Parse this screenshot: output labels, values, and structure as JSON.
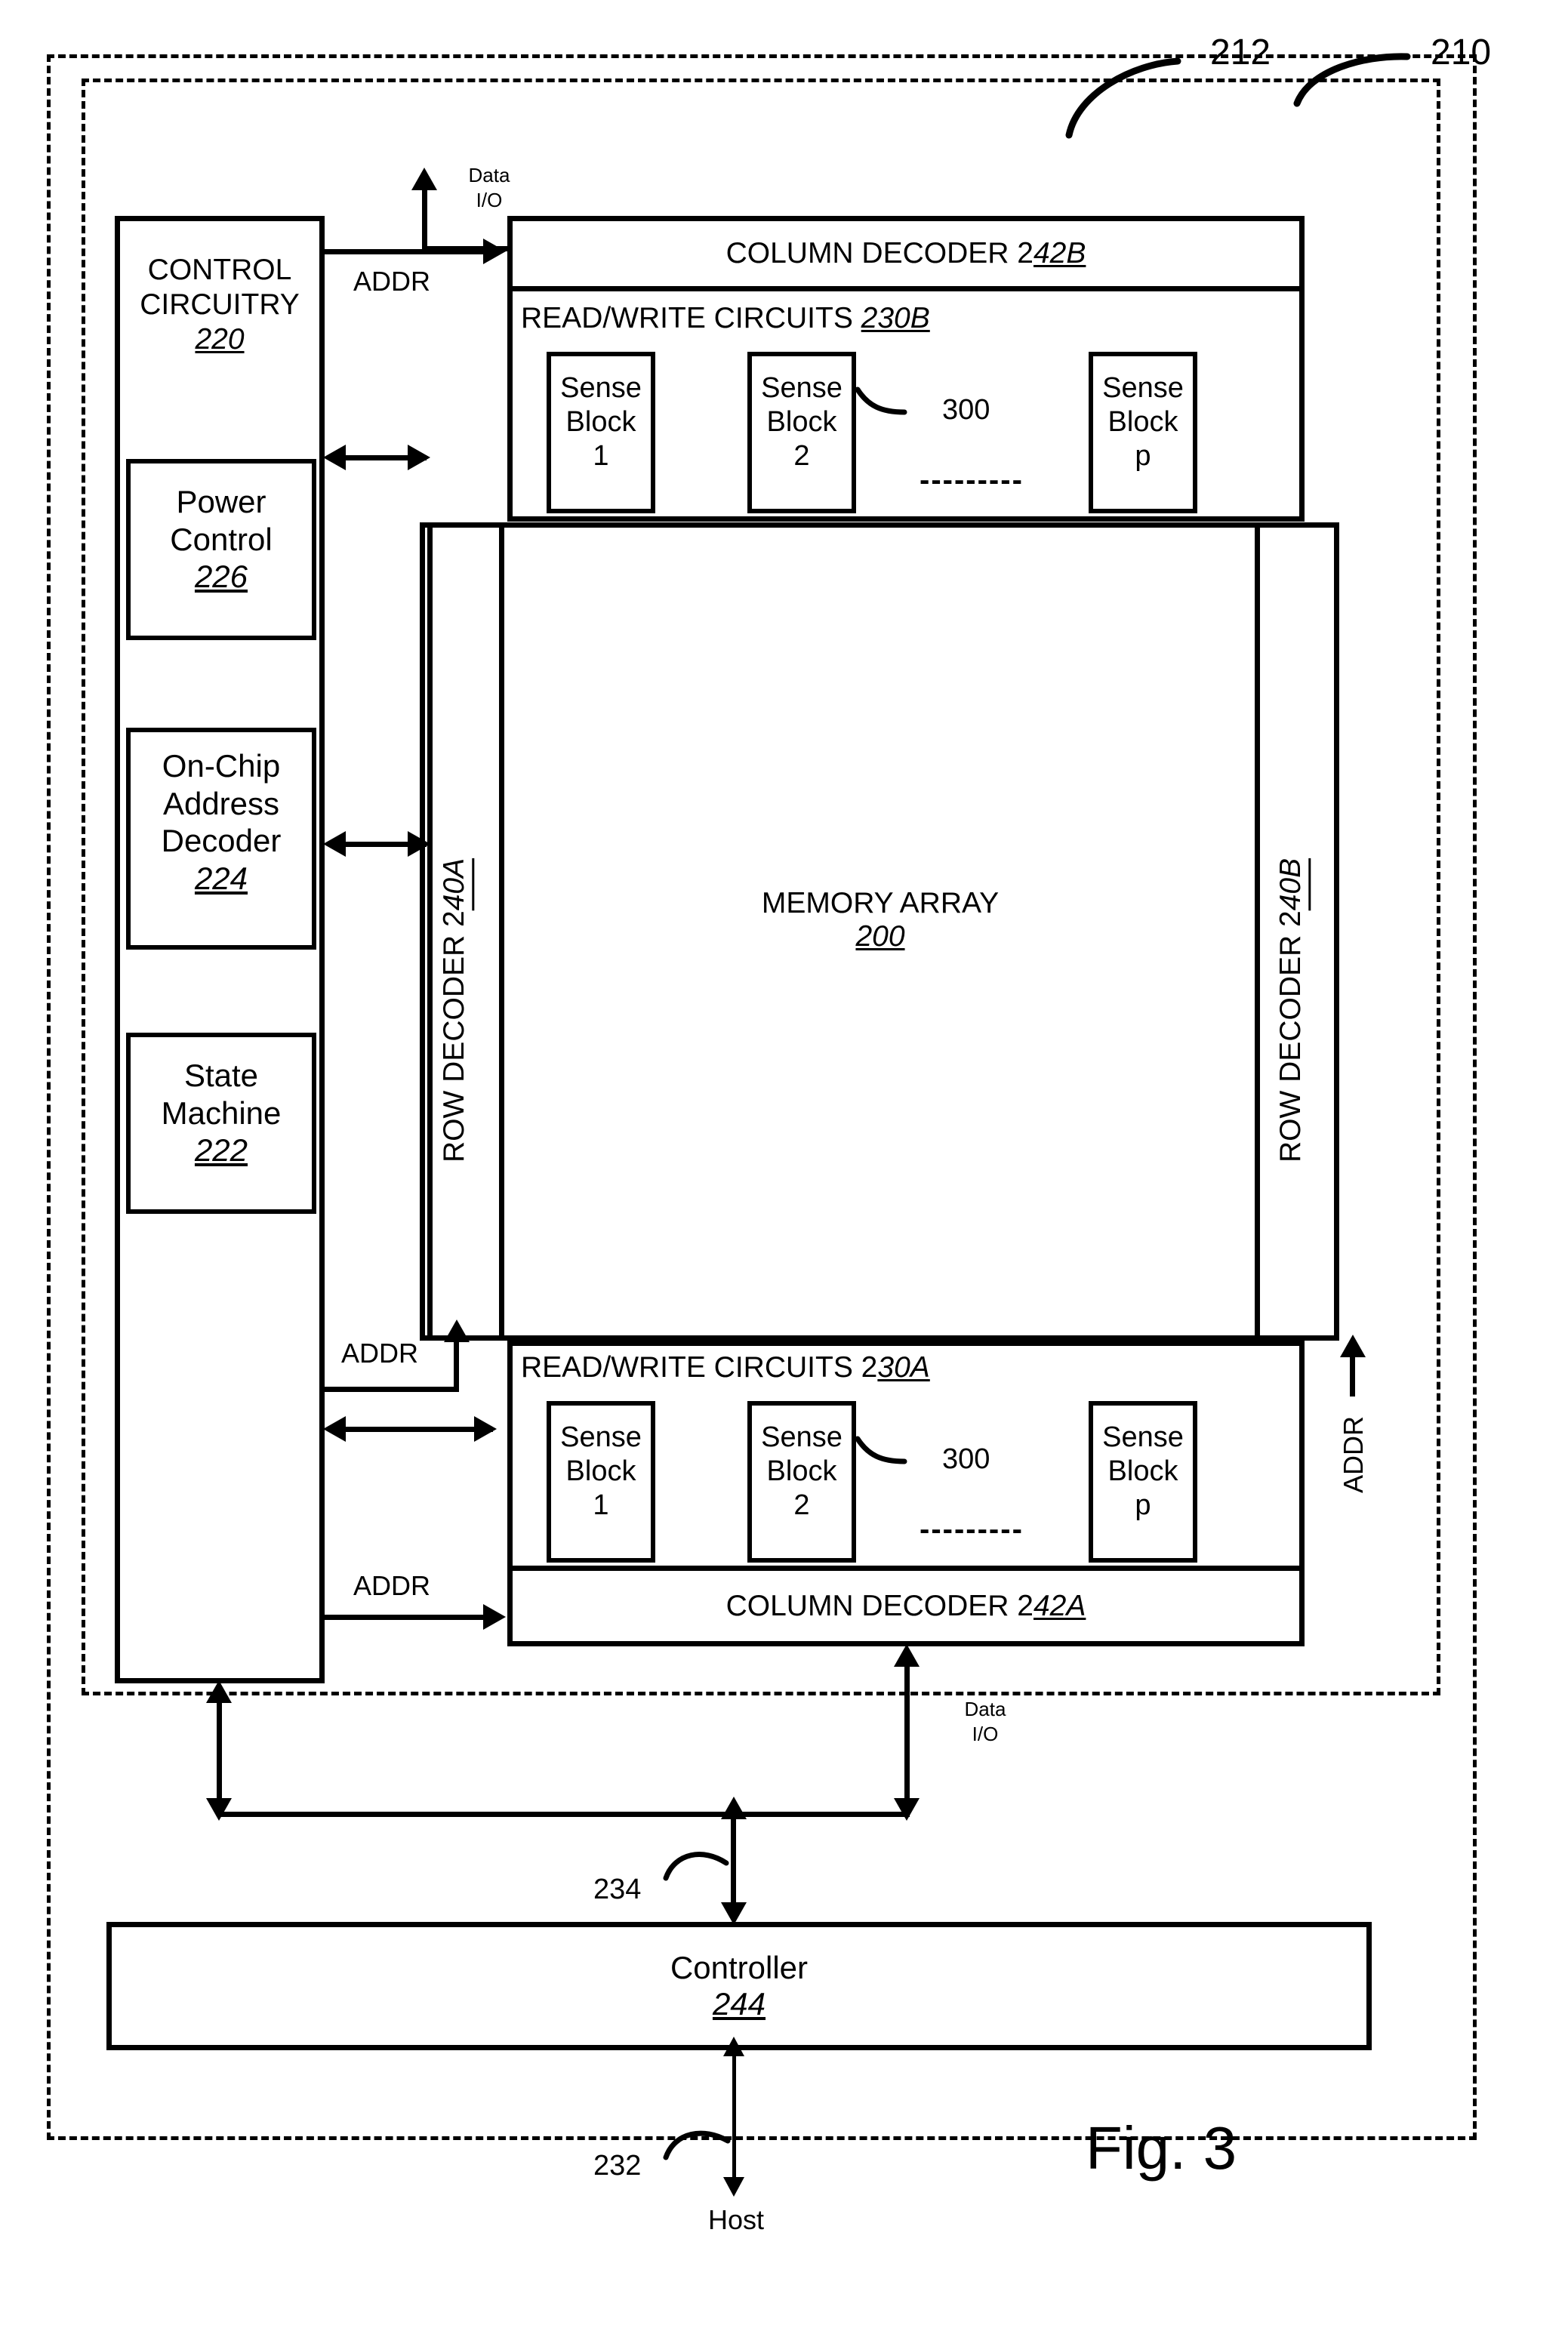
{
  "figure": {
    "caption": "Fig. 3",
    "outer_ref": "210",
    "inner_ref": "212"
  },
  "control": {
    "title_line1": "CONTROL",
    "title_line2": "CIRCUITRY",
    "ref": "220",
    "blocks": [
      {
        "name": "power-control",
        "line1": "Power",
        "line2": "Control",
        "ref": "226"
      },
      {
        "name": "on-chip-address-decoder",
        "line1": "On-Chip",
        "line2": "Address",
        "line3": "Decoder",
        "ref": "224"
      },
      {
        "name": "state-machine",
        "line1": "State",
        "line2": "Machine",
        "ref": "222"
      }
    ]
  },
  "column_decoder_top": {
    "label": "COLUMN DECODER 2",
    "ref": "42B"
  },
  "column_decoder_bottom": {
    "label": "COLUMN DECODER 2",
    "ref": "42A"
  },
  "read_write_top": {
    "label": "READ/WRITE CIRCUITS ",
    "ref": "230B",
    "callout": "300",
    "ellipsis": "---------",
    "sense_blocks": [
      {
        "line1": "Sense",
        "line2": "Block",
        "line3": "1"
      },
      {
        "line1": "Sense",
        "line2": "Block",
        "line3": "2"
      },
      {
        "line1": "Sense",
        "line2": "Block",
        "line3": "p"
      }
    ]
  },
  "read_write_bottom": {
    "label": "READ/WRITE CIRCUITS 2",
    "ref": "30A",
    "callout": "300",
    "ellipsis": "---------",
    "sense_blocks": [
      {
        "line1": "Sense",
        "line2": "Block",
        "line3": "1"
      },
      {
        "line1": "Sense",
        "line2": "Block",
        "line3": "2"
      },
      {
        "line1": "Sense",
        "line2": "Block",
        "line3": "p"
      }
    ]
  },
  "row_decoder_left": {
    "label": "ROW DECODER 2",
    "ref": "40A"
  },
  "row_decoder_right": {
    "label": "ROW DECODER 2",
    "ref": "40B"
  },
  "memory_array": {
    "label": "MEMORY ARRAY",
    "ref": "200"
  },
  "controller": {
    "label": "Controller",
    "ref": "244",
    "bus_ref": "234",
    "host_bus_ref": "232",
    "host_label": "Host"
  },
  "signals": {
    "addr_top": "ADDR",
    "addr_mid": "ADDR",
    "addr_bottom": "ADDR",
    "addr_right": "ADDR",
    "data_io_top_line1": "Data",
    "data_io_top_line2": "I/O",
    "data_io_bottom_line1": "Data",
    "data_io_bottom_line2": "I/O"
  }
}
